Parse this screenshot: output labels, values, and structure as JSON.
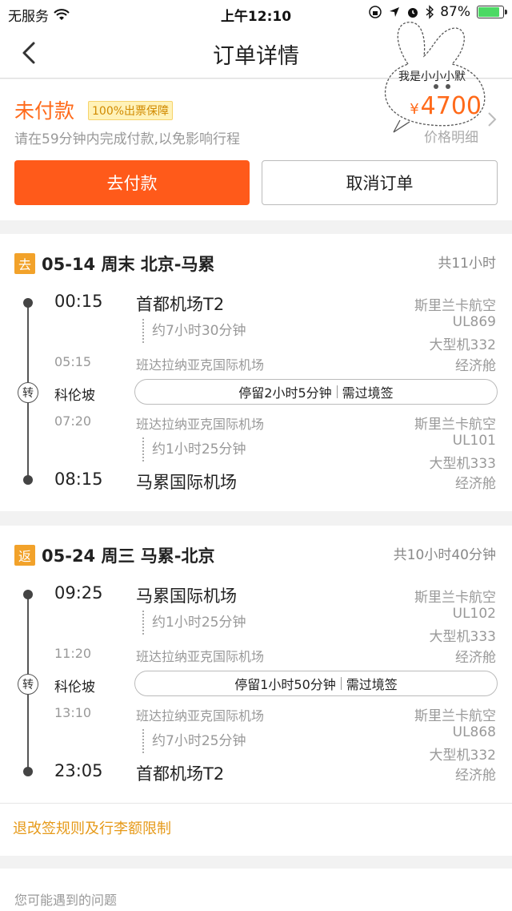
{
  "status_bar": {
    "carrier": "无服务",
    "time": "上午12:10",
    "battery": "87%",
    "battery_level": 0.87
  },
  "nav": {
    "title": "订单详情"
  },
  "order": {
    "status": "未付款",
    "guarantee": "100%出票保障",
    "hint": "请在59分钟内完成付款,以免影响行程",
    "price_symbol": "¥",
    "price": "4700",
    "price_detail": "价格明细",
    "pay_label": "去付款",
    "cancel_label": "取消订单",
    "doodle_text": "我是小小小默"
  },
  "outbound": {
    "badge": "去",
    "route": "05-14 周末 北京-马累",
    "total": "共11小时",
    "leg1": {
      "dep_time": "00:15",
      "dep_airport": "首都机场T2",
      "duration": "约7小时30分钟",
      "arr_time": "05:15",
      "arr_airport": "班达拉纳亚克国际机场",
      "airline": "斯里兰卡航空",
      "flight_no": "UL869",
      "aircraft": "大型机332",
      "cabin": "经济舱"
    },
    "transfer": {
      "icon": "转",
      "city": "科伦坡",
      "stay": "停留2小时5分钟",
      "visa": "需过境签"
    },
    "leg2": {
      "dep_time": "07:20",
      "dep_airport": "班达拉纳亚克国际机场",
      "duration": "约1小时25分钟",
      "arr_time": "08:15",
      "arr_airport": "马累国际机场",
      "airline": "斯里兰卡航空",
      "flight_no": "UL101",
      "aircraft": "大型机333",
      "cabin": "经济舱"
    }
  },
  "return": {
    "badge": "返",
    "route": "05-24 周三 马累-北京",
    "total": "共10小时40分钟",
    "leg1": {
      "dep_time": "09:25",
      "dep_airport": "马累国际机场",
      "duration": "约1小时25分钟",
      "arr_time": "11:20",
      "arr_airport": "班达拉纳亚克国际机场",
      "airline": "斯里兰卡航空",
      "flight_no": "UL102",
      "aircraft": "大型机333",
      "cabin": "经济舱"
    },
    "transfer": {
      "icon": "转",
      "city": "科伦坡",
      "stay": "停留1小时50分钟",
      "visa": "需过境签"
    },
    "leg2": {
      "dep_time": "13:10",
      "dep_airport": "班达拉纳亚克国际机场",
      "duration": "约7小时25分钟",
      "arr_time": "23:05",
      "arr_airport": "首都机场T2",
      "airline": "斯里兰卡航空",
      "flight_no": "UL868",
      "aircraft": "大型机332",
      "cabin": "经济舱"
    }
  },
  "rules_link": "退改签规则及行李额限制",
  "problems_title": "您可能遇到的问题",
  "colors": {
    "accent": "#ff5a1a",
    "badge": "#f2a22a",
    "link": "#e69a1a"
  }
}
